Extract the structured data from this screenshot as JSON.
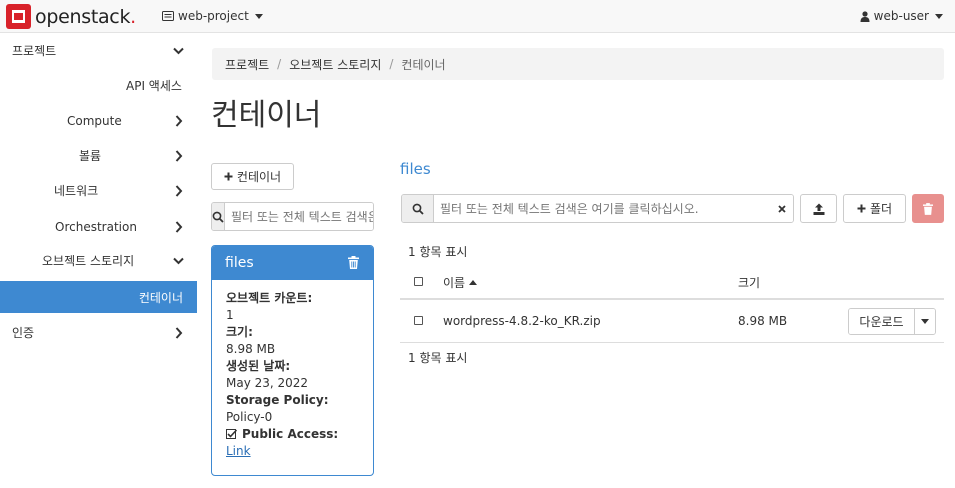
{
  "brand": {
    "name": "openstack",
    "dot": ".",
    "color": "#d8222a"
  },
  "header": {
    "project": "web-project",
    "user": "web-user"
  },
  "sidebar": {
    "items": [
      {
        "label": "프로젝트",
        "chevron": "down"
      },
      {
        "label": "API 액세스",
        "chevron": ""
      },
      {
        "label": "Compute",
        "chevron": "right"
      },
      {
        "label": "볼륨",
        "chevron": "right"
      },
      {
        "label": "네트워크",
        "chevron": "right"
      },
      {
        "label": "Orchestration",
        "chevron": "right"
      },
      {
        "label": "오브젝트 스토리지",
        "chevron": "down"
      },
      {
        "label": "컨테이너",
        "chevron": "",
        "active": true
      },
      {
        "label": "인증",
        "chevron": "right"
      }
    ],
    "active_color": "#3e89d1"
  },
  "breadcrumb": {
    "items": [
      "프로젝트",
      "오브젝트 스토리지",
      "컨테이너"
    ],
    "separator": "/"
  },
  "page": {
    "title": "컨테이너"
  },
  "containers_panel": {
    "add_button": "컨테이너",
    "search_placeholder": "필터 또는 전체 텍스트 검색은 여기를 클릭하십시오."
  },
  "container_card": {
    "name": "files",
    "object_count_label": "오브젝트 카운트:",
    "object_count": "1",
    "size_label": "크기:",
    "size": "8.98 MB",
    "created_label": "생성된 날짜:",
    "created": "May 23, 2022",
    "policy_label": "Storage Policy:",
    "policy": "Policy-0",
    "public_access_label": "Public Access:",
    "public_access_checked": true,
    "link": "Link"
  },
  "files_panel": {
    "heading": "files",
    "search_placeholder": "필터 또는 전체 텍스트 검색은 여기를 클릭하십시오.",
    "folder_button": "폴더",
    "count_top": "1 항목 표시",
    "count_bottom": "1 항목 표시",
    "columns": [
      "이름",
      "크기"
    ],
    "rows": [
      {
        "name": "wordpress-4.8.2-ko_KR.zip",
        "size": "8.98 MB",
        "action": "다운로드"
      }
    ],
    "delete_color": "#e67e7e"
  }
}
